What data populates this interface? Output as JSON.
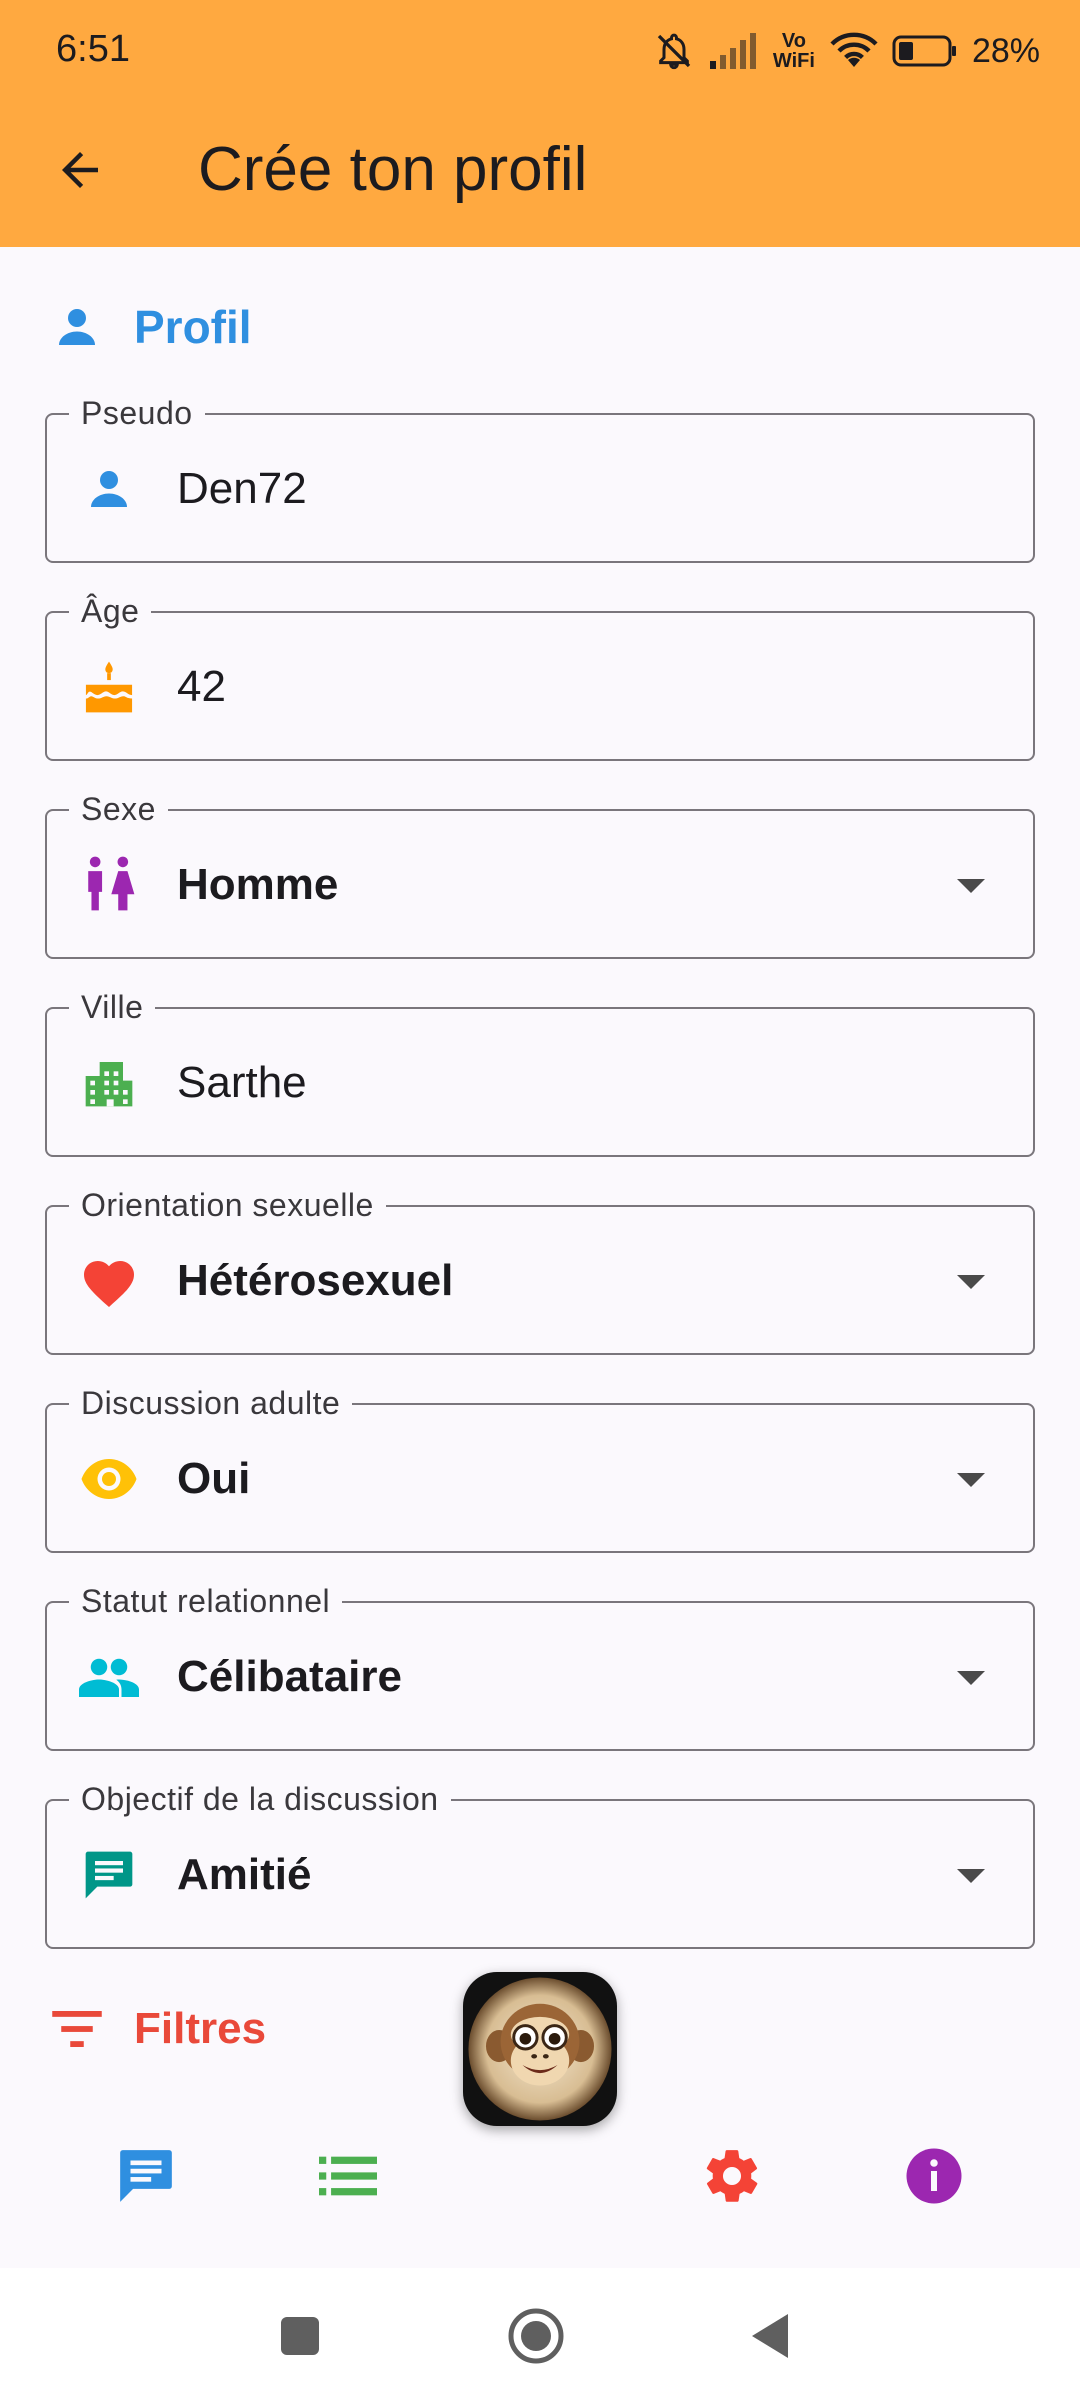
{
  "status_bar": {
    "time": "6:51",
    "vowifi": "Vo WiFi",
    "battery": "28%"
  },
  "app_bar": {
    "title": "Crée ton profil"
  },
  "section": {
    "title": "Profil"
  },
  "fields": [
    {
      "label": "Pseudo",
      "value": "Den72",
      "icon": "person-icon",
      "dropdown": false
    },
    {
      "label": "Âge",
      "value": "42",
      "icon": "cake-icon",
      "dropdown": false
    },
    {
      "label": "Sexe",
      "value": "Homme",
      "icon": "wc-icon",
      "dropdown": true
    },
    {
      "label": "Ville",
      "value": "Sarthe",
      "icon": "city-icon",
      "dropdown": false
    },
    {
      "label": "Orientation sexuelle",
      "value": "Hétérosexuel",
      "icon": "heart-icon",
      "dropdown": true
    },
    {
      "label": "Discussion adulte",
      "value": "Oui",
      "icon": "eye-icon",
      "dropdown": true
    },
    {
      "label": "Statut relationnel",
      "value": "Célibataire",
      "icon": "people-icon",
      "dropdown": true
    },
    {
      "label": "Objectif de la discussion",
      "value": "Amitié",
      "icon": "chat-icon",
      "dropdown": true
    }
  ],
  "filters": {
    "label": "Filtres"
  },
  "bottom_nav": {
    "items": [
      "chat-icon",
      "list-icon",
      "monkey-avatar",
      "settings-icon",
      "info-icon"
    ]
  },
  "colors": {
    "app_bar": "#ffa940",
    "blue": "#2f8fe0",
    "orange": "#ff9800",
    "purple": "#9c27b0",
    "green": "#4caf50",
    "red": "#f44336",
    "yellow": "#ffc107",
    "cyan": "#00bcd4",
    "teal": "#009688"
  }
}
